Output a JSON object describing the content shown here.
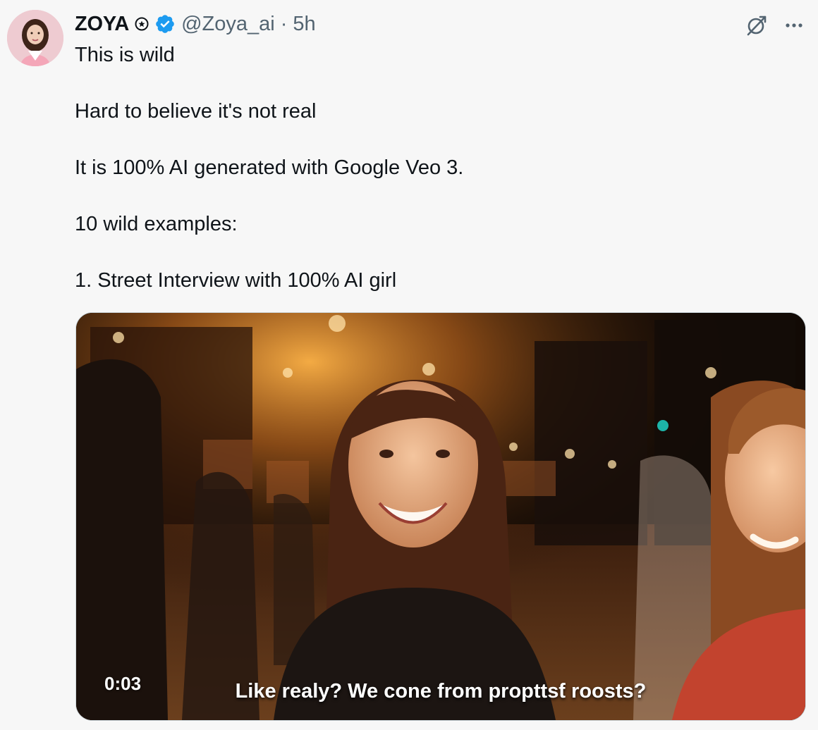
{
  "author": {
    "name": "ZOYA",
    "handle": "@Zoya_ai",
    "separator": "·",
    "time": "5h"
  },
  "body": {
    "lines": [
      "This is wild",
      "",
      "Hard to believe it's not real",
      "",
      "It is 100% AI generated with Google Veo 3.",
      "",
      "10 wild examples:",
      "",
      "1. Street Interview with 100% AI girl"
    ]
  },
  "video": {
    "timestamp": "0:03",
    "caption": "Like realy? We cone from propttsƭ roosts?"
  },
  "colors": {
    "verified": "#1d9bf0",
    "secondary_text": "#536471"
  },
  "icons": {
    "affiliate": "affiliate-badge-icon",
    "verified": "verified-badge-icon",
    "grok": "grok-icon",
    "more": "more-icon"
  }
}
